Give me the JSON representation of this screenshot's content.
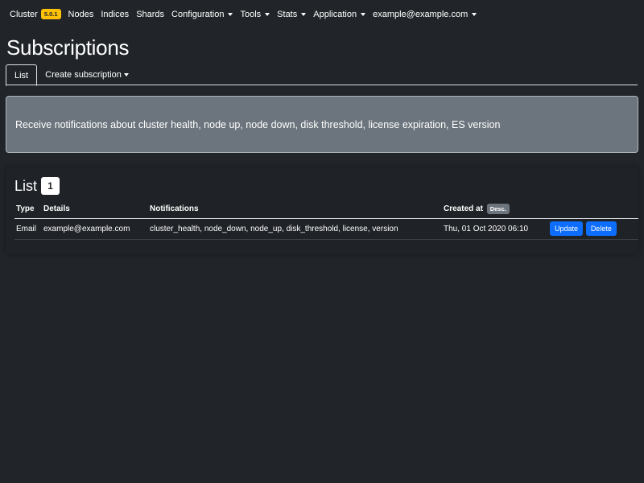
{
  "navbar": {
    "brand": "Cluster",
    "version": "5.0.1",
    "items": [
      {
        "label": "Nodes"
      },
      {
        "label": "Indices"
      },
      {
        "label": "Shards"
      },
      {
        "label": "Configuration"
      },
      {
        "label": "Tools"
      },
      {
        "label": "Stats"
      },
      {
        "label": "Application"
      },
      {
        "label": "example@example.com"
      }
    ]
  },
  "page": {
    "title": "Subscriptions"
  },
  "tabs": {
    "list": "List",
    "create": "Create subscription"
  },
  "alert": {
    "text": "Receive notifications about cluster health, node up, node down, disk threshold, license expiration, ES version"
  },
  "card": {
    "title": "List",
    "count": "1"
  },
  "table": {
    "headers": {
      "type": "Type",
      "details": "Details",
      "notifications": "Notifications",
      "created_at": "Created at",
      "sort": "Desc."
    },
    "rows": [
      {
        "type": "Email",
        "details": "example@example.com",
        "notifications": "cluster_health, node_down, node_up, disk_threshold, license, version",
        "created_at": "Thu, 01 Oct 2020 06:10",
        "update_label": "Update",
        "delete_label": "Delete"
      }
    ]
  },
  "colors": {
    "background": "#212529",
    "version_badge": "#ffc107",
    "alert_bg": "#6c757d",
    "primary_button": "#0d6efd"
  }
}
